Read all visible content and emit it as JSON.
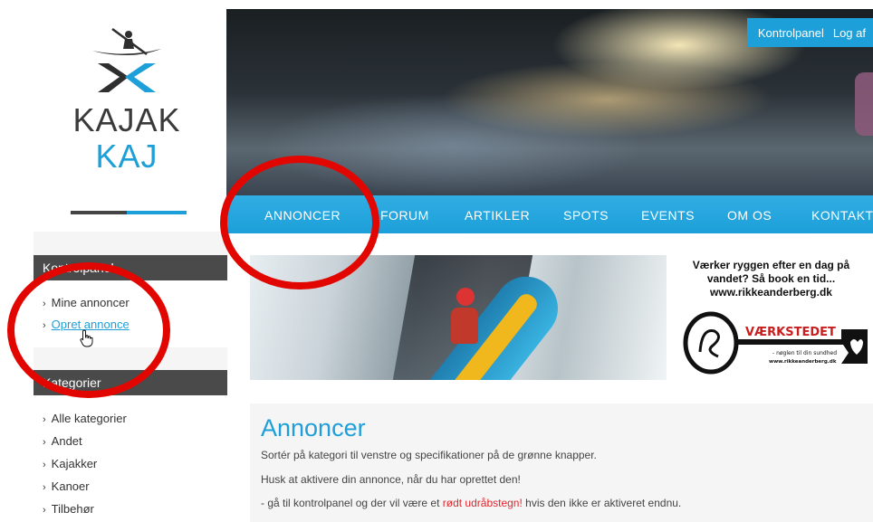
{
  "logo": {
    "line1": "KAJAK",
    "line2": "KAJ"
  },
  "colors": {
    "accent": "#1d9fd9",
    "dark": "#4a4a4a",
    "annotation": "#e10600",
    "alert": "#e3242b"
  },
  "top_links": {
    "control_panel": "Kontrolpanel",
    "logout": "Log af"
  },
  "nav": [
    "ANNONCER",
    "FORUM",
    "ARTIKLER",
    "SPOTS",
    "EVENTS",
    "OM OS",
    "KONTAKT"
  ],
  "sidebar": {
    "control_panel": {
      "title": "Kontrolpanel",
      "items": [
        "Mine annoncer",
        "Opret annonce"
      ]
    },
    "categories": {
      "title": "Kategorier",
      "items": [
        "Alle kategorier",
        "Andet",
        "Kajakker",
        "Kanoer",
        "Tilbehør"
      ]
    }
  },
  "ad": {
    "line1": "Værker ryggen efter en dag på",
    "line2": "vandet? Så book en tid...",
    "line3": "www.rikkeanderberg.dk",
    "brand": "VÆRKSTEDET",
    "tagline": "- nøglen til din sundhed",
    "url_small": "www.rikkeanderberg.dk"
  },
  "main": {
    "title": "Annoncer",
    "p1": "Sortér på kategori til venstre og specifikationer på de grønne knapper.",
    "p2": "Husk at aktivere din annonce, når du har oprettet den!",
    "p3_before": "- gå til kontrolpanel og der vil være et ",
    "p3_red": "rødt udråbstegn!",
    "p3_after": " hvis den ikke er aktiveret endnu."
  },
  "icons": {
    "logo": "kayaker-logo-icon",
    "chevron": "chevron-right-icon",
    "cursor": "hand-pointer-icon"
  }
}
